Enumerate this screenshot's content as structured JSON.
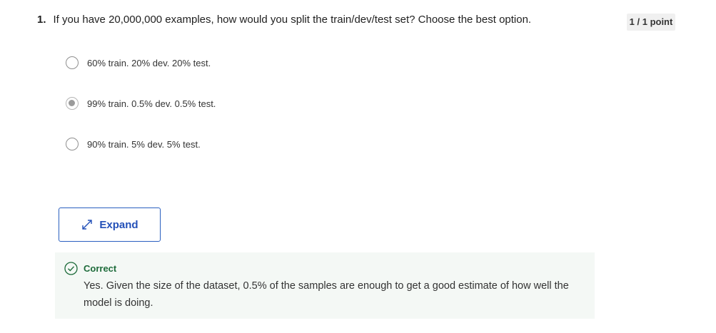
{
  "question": {
    "number": "1.",
    "text": "If you have 20,000,000 examples, how would you split the train/dev/test set? Choose the best option.",
    "points": "1 / 1 point"
  },
  "options": [
    {
      "label": "60% train. 20% dev. 20% test.",
      "selected": false
    },
    {
      "label": "99% train. 0.5% dev. 0.5% test.",
      "selected": true
    },
    {
      "label": "90% train. 5% dev. 5% test.",
      "selected": false
    }
  ],
  "expand": {
    "label": "Expand",
    "icon": "expand-arrows-icon"
  },
  "feedback": {
    "status": "Correct",
    "icon": "check-circle-icon",
    "text": "Yes. Given the size of the dataset, 0.5% of the samples are enough to get a good estimate of how well the model is doing."
  },
  "colors": {
    "accent": "#2350b8",
    "correct": "#1d6b3a",
    "feedback_bg": "#f4f8f5"
  }
}
